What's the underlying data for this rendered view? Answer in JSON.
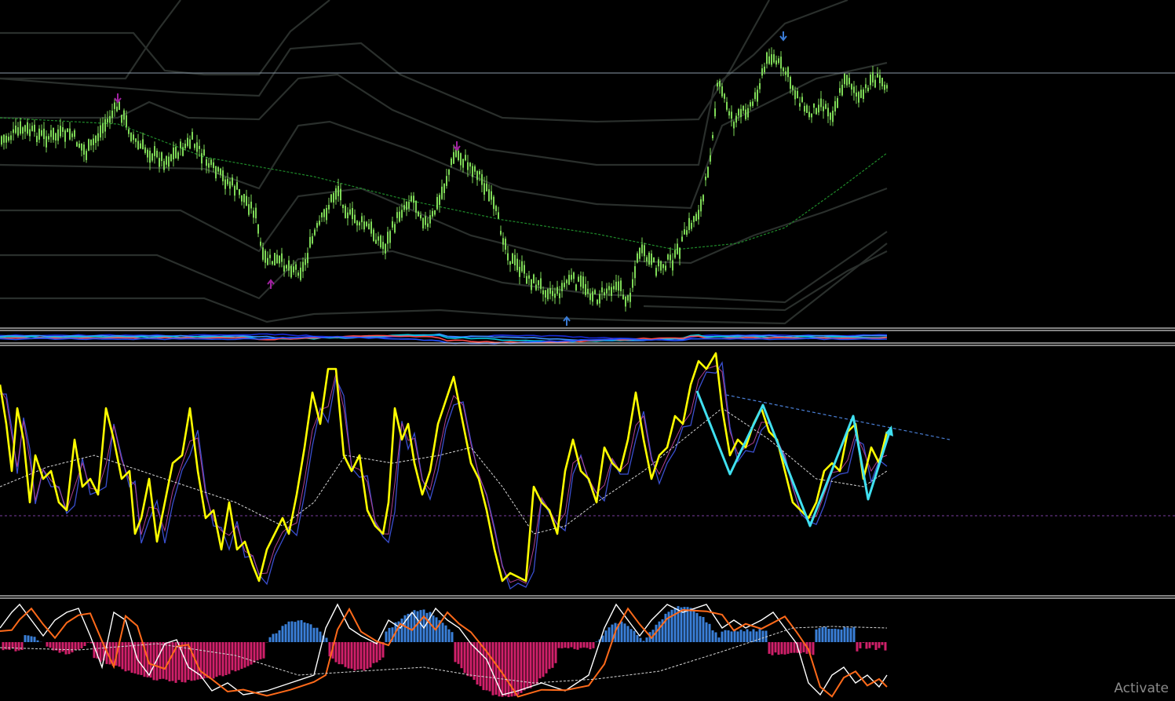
{
  "watermark": {
    "text": "Activate"
  },
  "colors": {
    "background": "#000000",
    "candle": "#7ed957",
    "band": "#2a2f2c",
    "ma_green": "#1f8a2a",
    "hline": "#8a9aa8",
    "separator": "#d0d0d0",
    "arrow_up": "#3a7bd5",
    "arrow_down_magenta": "#a020a0",
    "stoch_main": "#ffff00",
    "stoch_sig_blue": "#3a4fd0",
    "stoch_sig_purple": "#b04090",
    "stoch_ma": "#d8d8d8",
    "zigzag": "#40e0f0",
    "trend": "#4a7fd6",
    "level_mid": "#7a3ea0",
    "hist_pos": "#3a7fd8",
    "hist_neg": "#d0206a",
    "osc_white": "#ffffff",
    "osc_orange": "#ff6a1a"
  },
  "panels": [
    {
      "name": "price",
      "icons": [
        "arrow-down-magenta-icon",
        "arrow-down-magenta-icon",
        "arrow-down-blue-icon",
        "arrow-up-magenta-icon",
        "arrow-up-blue-icon"
      ]
    },
    {
      "name": "strip"
    },
    {
      "name": "stochastic"
    },
    {
      "name": "macd"
    }
  ]
}
